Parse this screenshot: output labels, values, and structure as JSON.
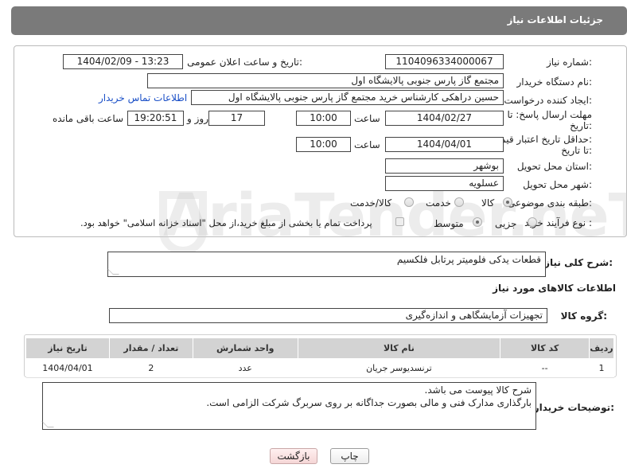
{
  "header": {
    "title": "جزئیات اطلاعات نیاز"
  },
  "fields": {
    "need_number_label": "شماره نیاز:",
    "need_number": "1104096334000067",
    "announce_label": "تاریخ و ساعت اعلان عمومی:",
    "announce_value": "1404/02/09 - 13:23",
    "buyer_org_label": "نام دستگاه خریدار:",
    "buyer_org": "مجتمع گاز پارس جنوبی  پالایشگاه اول",
    "requester_label": "ایجاد کننده درخواست:",
    "requester": "حسین دراهکی کارشناس خرید مجتمع گاز پارس جنوبی  پالایشگاه اول",
    "contact_link": "اطلاعات تماس خریدار",
    "deadline_label_1": "مهلت ارسال پاسخ: تا",
    "deadline_label_2": "تاریخ:",
    "deadline_date": "1404/02/27",
    "time_label": "ساعت",
    "deadline_time": "10:00",
    "days_value": "17",
    "days_label": "روز و",
    "remaining_time": "19:20:51",
    "remaining_label": "ساعت باقی مانده",
    "validity_label_1": "حداقل تاریخ اعتبار قیمت:",
    "validity_label_2": "تا تاریخ:",
    "validity_date": "1404/04/01",
    "validity_time": "10:00",
    "province_label": "استان محل تحویل:",
    "province": "بوشهر",
    "city_label": "شهر محل تحویل:",
    "city": "عسلویه",
    "category_label": "طبقه بندی موضوعی:",
    "category_options": [
      "کالا",
      "خدمت",
      "کالا/خدمت"
    ],
    "process_label": "نوع فرآیند خرید :",
    "process_options": [
      "جزیی",
      "متوسط"
    ],
    "payment_note": "پرداخت تمام یا بخشی از مبلغ خرید،از محل \"اسناد خزانه اسلامی\" خواهد بود."
  },
  "description": {
    "label": "شرح کلی نیاز:",
    "value": "قطعات یدکی فلومیتر پرتابل فلکسیم"
  },
  "goods": {
    "section_title": "اطلاعات کالاهای مورد نیاز",
    "group_label": "گروه کالا:",
    "group_value": "تجهیزات آزمایشگاهی و اندازه‌گیری"
  },
  "table": {
    "headers": [
      "ردیف",
      "کد کالا",
      "نام کالا",
      "واحد شمارش",
      "تعداد / مقدار",
      "تاریخ نیاز"
    ],
    "rows": [
      [
        "1",
        "--",
        "ترنسدیوسر جریان",
        "عدد",
        "2",
        "1404/04/01"
      ]
    ]
  },
  "buyer_notes": {
    "label": "توضیحات خریدار:",
    "line1": "شرح کالا پیوست می باشد.",
    "line2": "بارگذاری مدارک فنی و مالی بصورت جداگانه بر روی سربرگ شرکت الزامی است."
  },
  "buttons": {
    "print": "چاپ",
    "back": "بازگشت"
  },
  "watermark": "AriaTender.neT",
  "colors": {
    "topbar": "#7a7a7a",
    "link": "#1a4fc7",
    "table_header": "#d3d3d3"
  }
}
